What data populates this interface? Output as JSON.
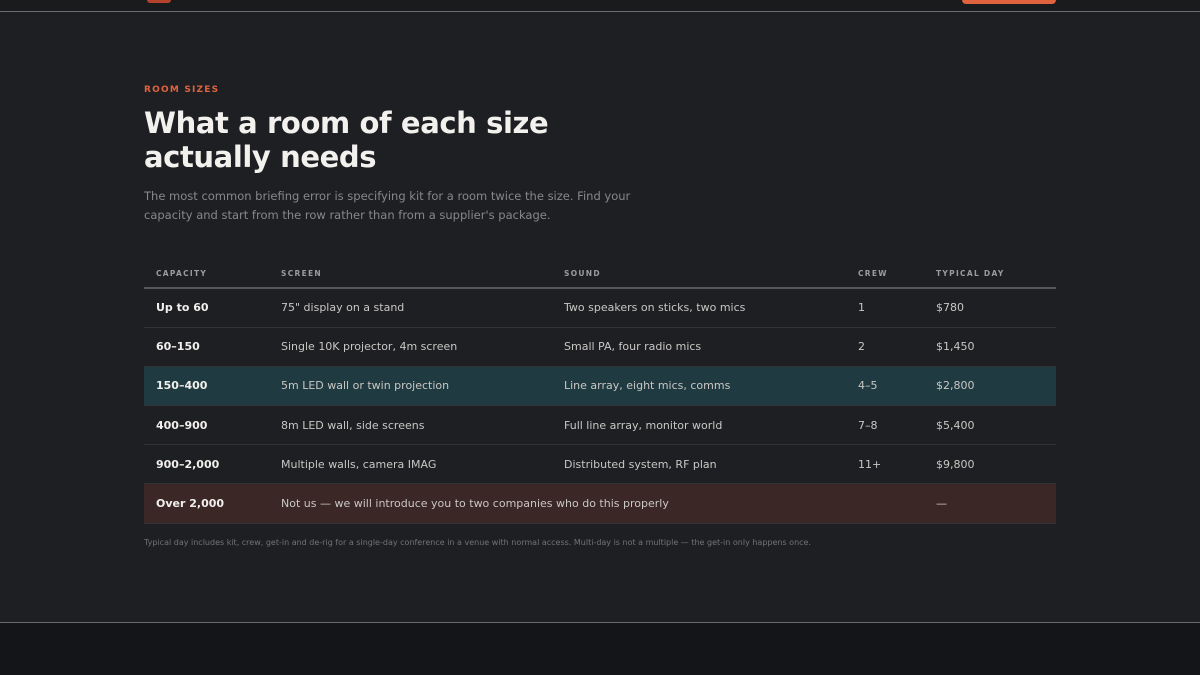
{
  "header": {
    "logo_color": "#b5432b",
    "cta_color": "#e0623f"
  },
  "section": {
    "eyebrow": "ROOM SIZES",
    "title": "What a room of each size actually needs",
    "intro": "The most common briefing error is specifying kit for a room twice the size. Find your capacity and start from the row rather than from a supplier's package."
  },
  "table": {
    "columns": [
      "CAPACITY",
      "SCREEN",
      "SOUND",
      "CREW",
      "TYPICAL DAY"
    ],
    "rows": [
      {
        "capacity": "Up to 60",
        "screen": "75\" display on a stand",
        "sound": "Two speakers on sticks, two mics",
        "crew": "1",
        "typical_day": "$780"
      },
      {
        "capacity": "60–150",
        "screen": "Single 10K projector, 4m screen",
        "sound": "Small PA, four radio mics",
        "crew": "2",
        "typical_day": "$1,450"
      },
      {
        "capacity": "150–400",
        "screen": "5m LED wall or twin projection",
        "sound": "Line array, eight mics, comms",
        "crew": "4–5",
        "typical_day": "$2,800"
      },
      {
        "capacity": "400–900",
        "screen": "8m LED wall, side screens",
        "sound": "Full line array, monitor world",
        "crew": "7–8",
        "typical_day": "$5,400"
      },
      {
        "capacity": "900–2,000",
        "screen": "Multiple walls, camera IMAG",
        "sound": "Distributed system, RF plan",
        "crew": "11+",
        "typical_day": "$9,800"
      },
      {
        "capacity": "Over 2,000",
        "note": "Not us — we will introduce you to two companies who do this properly",
        "typical_day": "—"
      }
    ],
    "highlight_color": "#1f3a40",
    "declined_color": "#3a2726"
  },
  "footnote": "Typical day includes kit, crew, get-in and de-rig for a single-day conference in a venue with normal access. Multi-day is not a multiple — the get-in only happens once."
}
